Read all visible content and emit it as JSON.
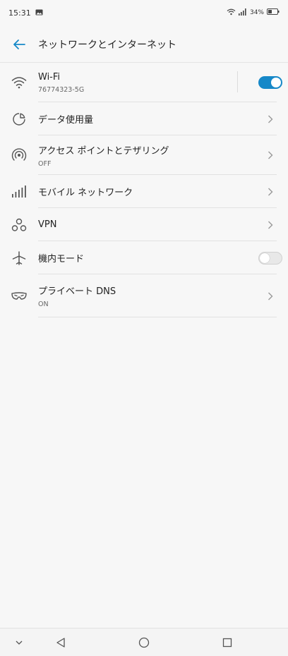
{
  "status_bar": {
    "time": "15:31",
    "battery": "34%",
    "icons": [
      "image-notification-icon",
      "wifi-icon",
      "signal-icon",
      "battery-icon"
    ]
  },
  "header": {
    "title": "ネットワークとインターネット"
  },
  "settings": [
    {
      "title": "Wi-Fi",
      "subtitle": "76774323-5G",
      "icon": "wifi-icon",
      "control": "toggle",
      "state": "on"
    },
    {
      "title": "データ使用量",
      "subtitle": "",
      "icon": "data-usage-icon",
      "control": "chevron"
    },
    {
      "title": "アクセス ポイントとテザリング",
      "subtitle": "OFF",
      "icon": "hotspot-icon",
      "control": "chevron"
    },
    {
      "title": "モバイル ネットワーク",
      "subtitle": "",
      "icon": "cellular-icon",
      "control": "chevron"
    },
    {
      "title": "VPN",
      "subtitle": "",
      "icon": "vpn-icon",
      "control": "chevron"
    },
    {
      "title": "機内モード",
      "subtitle": "",
      "icon": "airplane-icon",
      "control": "toggle",
      "state": "off"
    },
    {
      "title": "プライベート DNS",
      "subtitle": "ON",
      "icon": "private-dns-icon",
      "control": "chevron"
    }
  ],
  "colors": {
    "accent": "#1688c8",
    "background": "#f7f7f7"
  }
}
